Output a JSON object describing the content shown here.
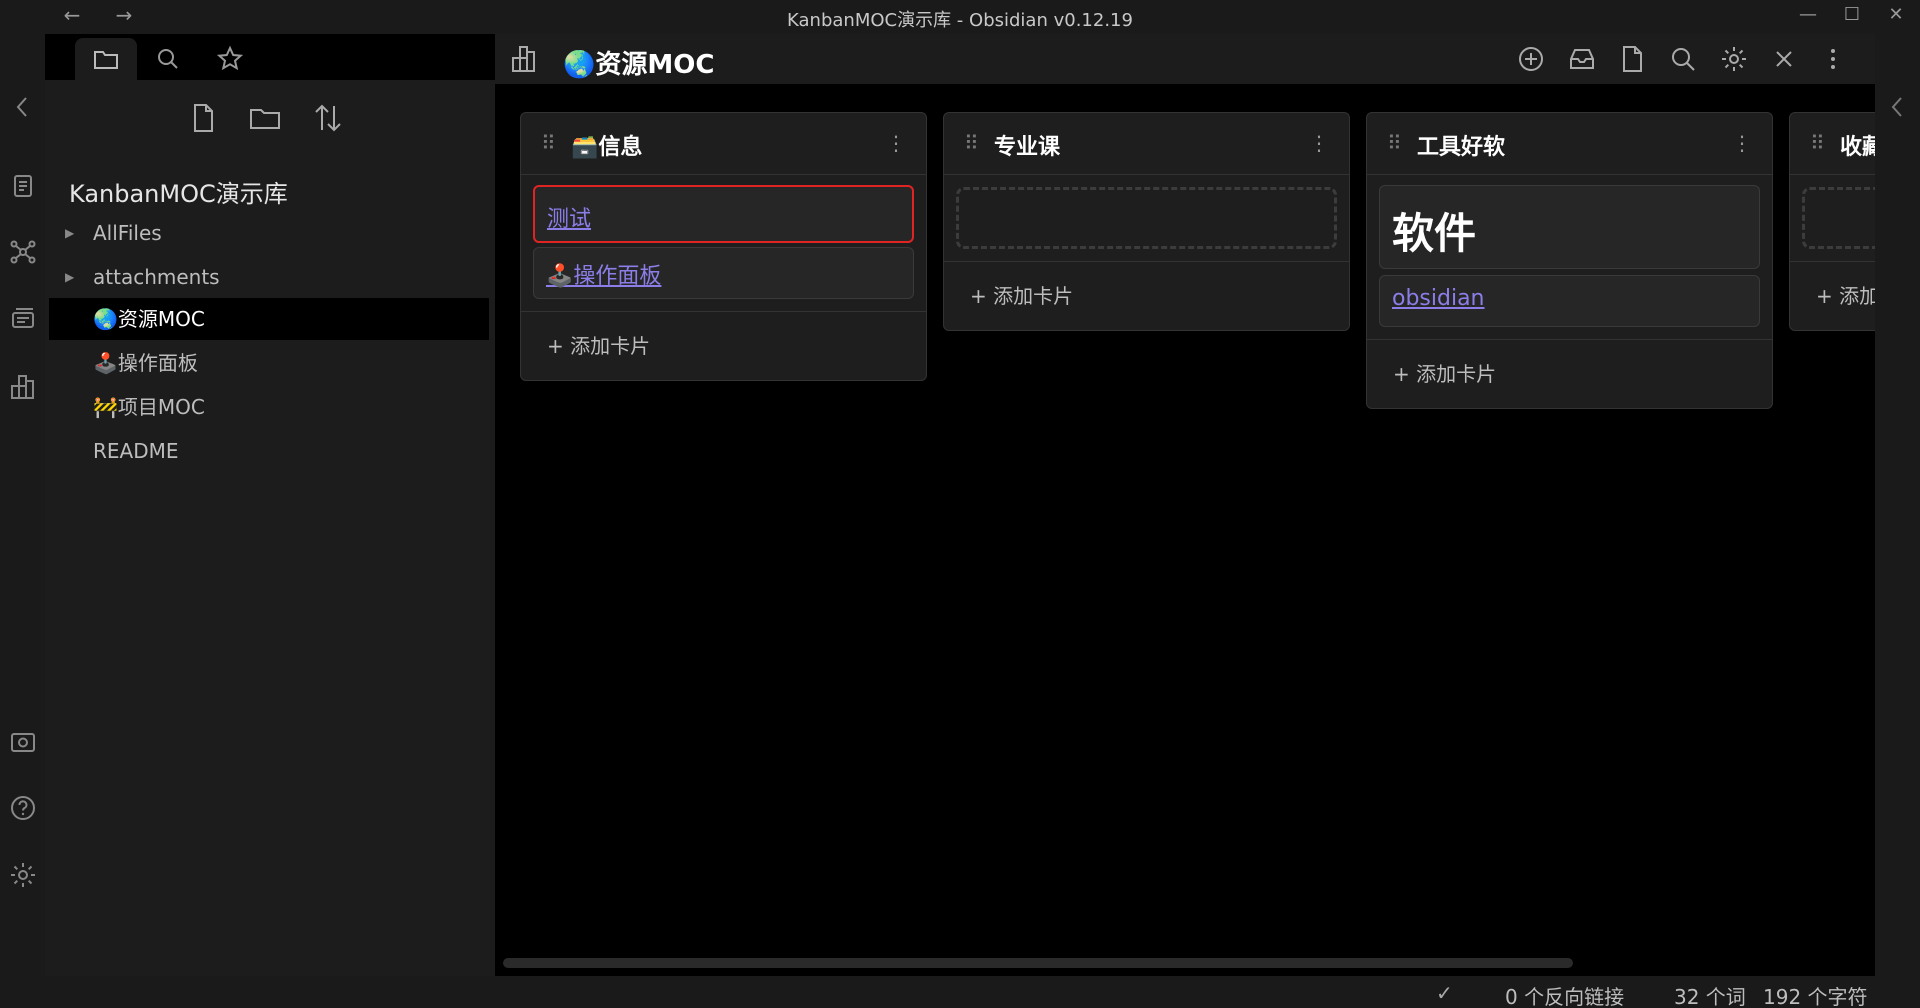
{
  "titlebar": {
    "title": "KanbanMOC演示库 - Obsidian v0.12.19",
    "back": "←",
    "forward": "→",
    "minimize": "—",
    "maximize": "☐",
    "close": "✕"
  },
  "ribbon": {
    "icons": [
      "collapse-left-icon",
      "open-quick-switcher-icon",
      "graph-view-icon",
      "slides-icon",
      "kanban-icon",
      "camera-icon",
      "help-icon",
      "settings-icon"
    ]
  },
  "sidebar": {
    "vault_name": "KanbanMOC演示库",
    "items": [
      {
        "label": "AllFiles",
        "folder": true
      },
      {
        "label": "attachments",
        "folder": true
      },
      {
        "label": "🌏资源MOC",
        "active": true
      },
      {
        "label": "🕹️操作面板"
      },
      {
        "label": "🚧项目MOC"
      },
      {
        "label": "README"
      }
    ]
  },
  "pane": {
    "title": "🌏资源MOC",
    "header_icons": [
      "add-icon",
      "archive-icon",
      "file-icon",
      "search-icon",
      "gear-icon",
      "close-icon",
      "more-icon"
    ]
  },
  "board": {
    "lanes": [
      {
        "title": "🗃️信息",
        "cards": [
          "测试",
          "🕹️操作面板"
        ],
        "add_label": "+ 添加卡片"
      },
      {
        "title": "专业课",
        "cards": [],
        "add_label": "+ 添加卡片"
      },
      {
        "title": "工具好软",
        "heading_card": "软件",
        "cards": [
          "obsidian"
        ],
        "add_label": "+ 添加卡片"
      },
      {
        "title": "收藏",
        "cards": [],
        "add_label": "+ 添加"
      }
    ],
    "grip": "⠿",
    "more": "⋮"
  },
  "statusbar": {
    "check": "✓",
    "backlinks": "0 个反向链接",
    "words": "32 个词",
    "chars": "192 个字符"
  },
  "colors": {
    "link": "#8b7ee8",
    "highlight_border": "#e02424",
    "background": "#000000"
  }
}
